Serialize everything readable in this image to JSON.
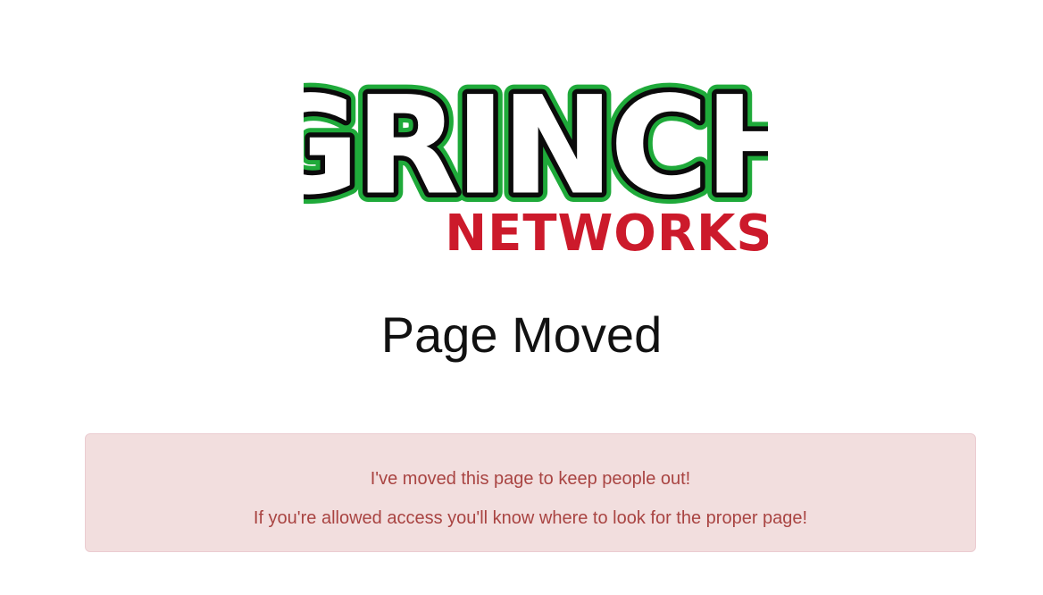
{
  "logo": {
    "text_top": "GRINCH",
    "text_bottom": "NETWORKS",
    "colors": {
      "outline": "#0b0b0b",
      "glow": "#1faa3a",
      "fill": "#ffffff",
      "networks": "#cc1a2b"
    }
  },
  "page": {
    "title": "Page Moved"
  },
  "alert": {
    "line1": "I've moved this page to keep people out!",
    "line2": "If you're allowed access you'll know where to look for the proper page!",
    "colors": {
      "background": "#f2dede",
      "border": "#ebccd1",
      "text": "#a94442"
    }
  }
}
